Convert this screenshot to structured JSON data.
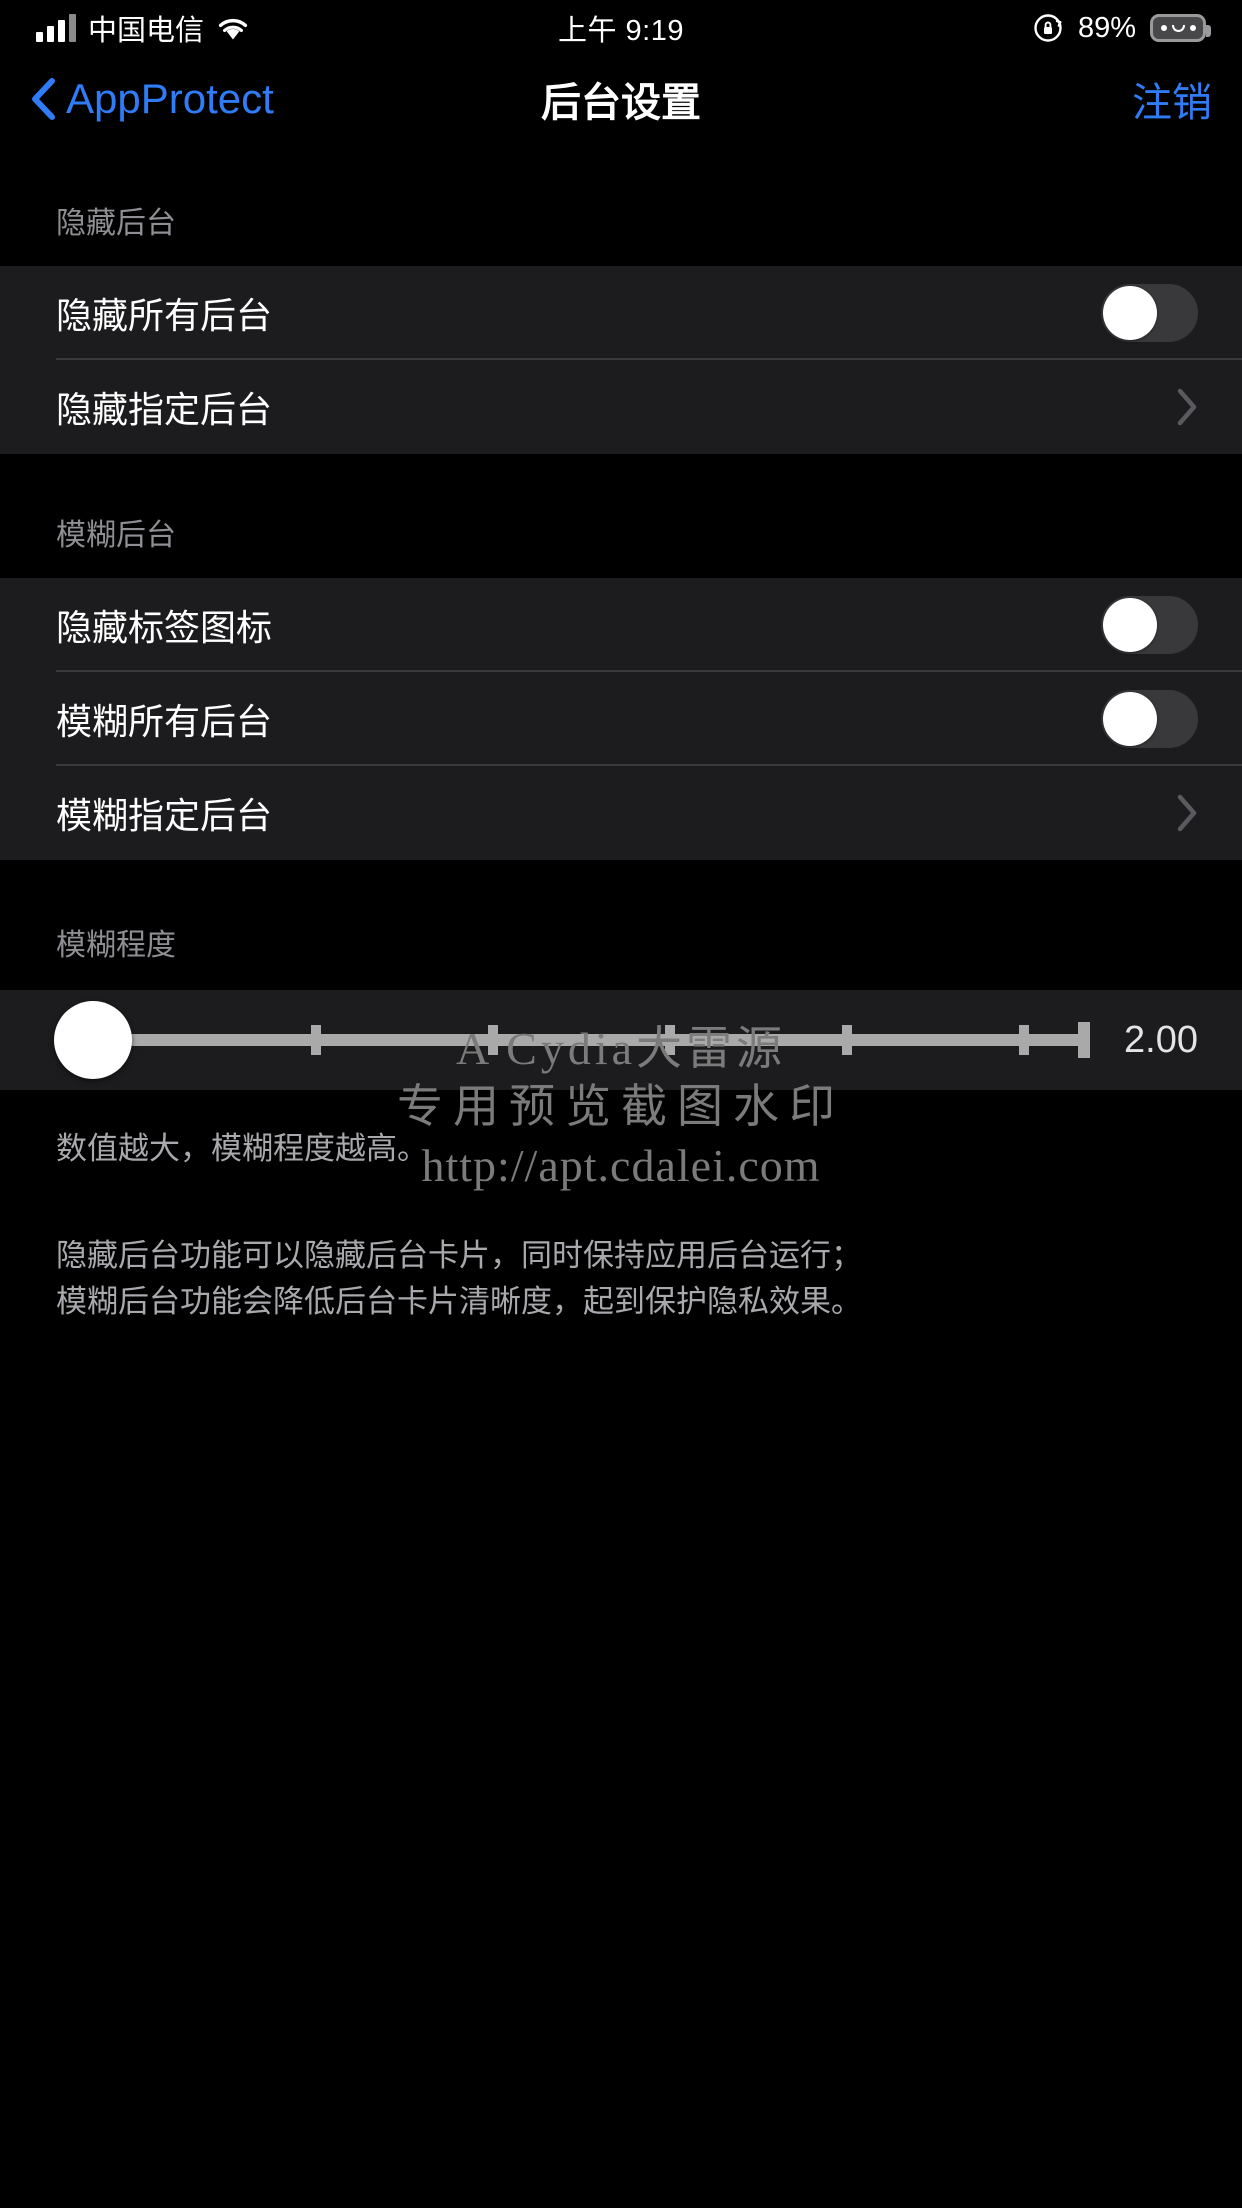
{
  "status_bar": {
    "carrier": "中国电信",
    "signal_icon": "cellular-bars-icon",
    "wifi_icon": "wifi-icon",
    "time": "上午 9:19",
    "rotation_lock_icon": "rotation-lock-icon",
    "battery_percent": "89%",
    "battery_icon": "battery-icon"
  },
  "nav": {
    "back_icon": "chevron-left-icon",
    "back_label": "AppProtect",
    "title": "后台设置",
    "right_label": "注销"
  },
  "sections": [
    {
      "header": "隐藏后台",
      "rows": [
        {
          "label": "隐藏所有后台",
          "accessory": "switch",
          "value": "off"
        },
        {
          "label": "隐藏指定后台",
          "accessory": "chevron",
          "value": ""
        }
      ]
    },
    {
      "header": "模糊后台",
      "rows": [
        {
          "label": "隐藏标签图标",
          "accessory": "switch",
          "value": "off"
        },
        {
          "label": "模糊所有后台",
          "accessory": "switch",
          "value": "off"
        },
        {
          "label": "模糊指定后台",
          "accessory": "chevron",
          "value": ""
        }
      ]
    },
    {
      "header": "模糊程度",
      "slider": {
        "value": "2.00",
        "knob_position_percent": 0,
        "tick_count": 5
      },
      "footer": "数值越大，模糊程度越高。"
    }
  ],
  "footer_note": {
    "line1": "隐藏后台功能可以隐藏后台卡片，同时保持应用后台运行；",
    "line2": "模糊后台功能会降低后台卡片清晰度，起到保护隐私效果。"
  },
  "watermark": {
    "line1": "A Cydia大雷源",
    "line2": "专用预览截图水印",
    "line3": "http://apt.cdalei.com"
  },
  "colors": {
    "accent_blue": "#2f7cf6",
    "group_bg": "#1c1c1e",
    "page_bg": "#000000",
    "separator": "#3a3a3c",
    "secondary_text": "#8e8e93",
    "switch_off_track": "#39393c",
    "slider_track": "#a9a9a9"
  }
}
